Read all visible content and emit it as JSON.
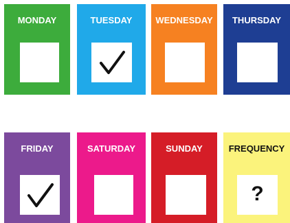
{
  "days": [
    {
      "label": "MONDAY",
      "color": "#3dac3c",
      "mark": "empty"
    },
    {
      "label": "TUESDAY",
      "color": "#20a9e9",
      "mark": "check"
    },
    {
      "label": "WEDNESDAY",
      "color": "#f68121",
      "mark": "empty"
    },
    {
      "label": "THURSDAY",
      "color": "#1e3e93",
      "mark": "empty"
    },
    {
      "label": "FRIDAY",
      "color": "#7c4a9d",
      "mark": "check"
    },
    {
      "label": "SATURDAY",
      "color": "#ec1a8b",
      "mark": "empty"
    },
    {
      "label": "SUNDAY",
      "color": "#d51d27",
      "mark": "empty"
    },
    {
      "label": "FREQUENCY",
      "color": "#fbf37c",
      "mark": "question",
      "question_text": "?"
    }
  ]
}
